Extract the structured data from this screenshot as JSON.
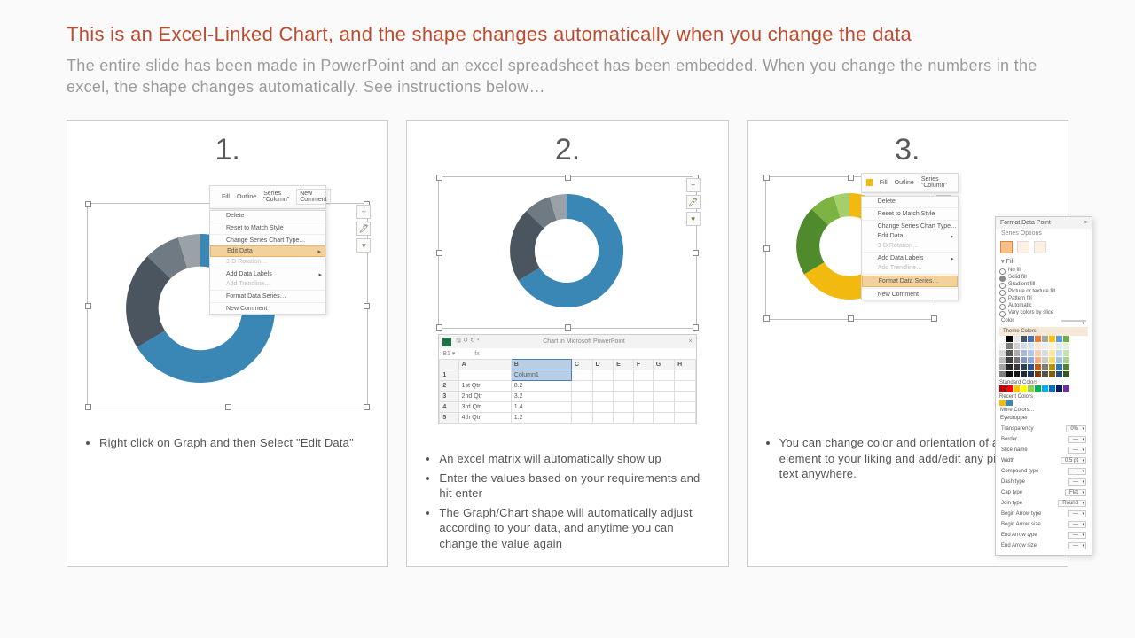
{
  "title": "This is an Excel-Linked Chart, and the shape changes automatically when you change the data",
  "subtitle": "The entire slide has been made in PowerPoint and an excel spreadsheet has been embedded. When you change the numbers in the excel, the shape changes automatically. See instructions below…",
  "cards": [
    {
      "num": "1.",
      "instructions": [
        "Right click on Graph and then Select \"Edit Data\""
      ],
      "menu_top": [
        "Fill",
        "Outline",
        "Series \"Column\"",
        "New Comment"
      ],
      "menu": [
        "Delete",
        "Reset to Match Style",
        "Change Series Chart Type…",
        "Edit Data",
        "3-D Rotation…",
        "Add Data Labels",
        "Add Trendline…",
        "Format Data Series…",
        "New Comment"
      ],
      "menu_highlight": 3
    },
    {
      "num": "2.",
      "instructions": [
        "An excel matrix will automatically show up",
        "Enter the values based on your requirements and hit enter",
        "The Graph/Chart shape will automatically adjust according to your data, and anytime you can change the value again"
      ],
      "sheet_title": "Chart in Microsoft PowerPoint",
      "sheet": {
        "cols": [
          "",
          "A",
          "B",
          "C",
          "D",
          "E",
          "F",
          "G",
          "H"
        ],
        "selcol": "Column1",
        "rows": [
          [
            "1",
            "",
            "Column1",
            "",
            "",
            "",
            "",
            "",
            ""
          ],
          [
            "2",
            "1st Qtr",
            "8.2",
            "",
            "",
            "",
            "",
            "",
            ""
          ],
          [
            "3",
            "2nd Qtr",
            "3.2",
            "",
            "",
            "",
            "",
            "",
            ""
          ],
          [
            "4",
            "3rd Qtr",
            "1.4",
            "",
            "",
            "",
            "",
            "",
            ""
          ],
          [
            "5",
            "4th Qtr",
            "1.2",
            "",
            "",
            "",
            "",
            "",
            ""
          ]
        ]
      }
    },
    {
      "num": "3.",
      "instructions": [
        "You can change color and orientation of any element to your liking and add/edit any piece of text anywhere."
      ],
      "menu_top": [
        "Fill",
        "Outline",
        "Series \"Column\"",
        "New Comment"
      ],
      "menu": [
        "Delete",
        "Reset to Match Style",
        "Change Series Chart Type…",
        "Edit Data",
        "3-D Rotation…",
        "Add Data Labels",
        "Add Trendline…",
        "Format Data Series…",
        "New Comment"
      ],
      "menu_highlight": 7,
      "panel": {
        "title": "Format Data Point",
        "subtitle": "Series Options",
        "fill_label": "Fill",
        "fill_opts": [
          "No fill",
          "Solid fill",
          "Gradient fill",
          "Picture or texture fill",
          "Pattern fill",
          "Automatic",
          "Vary colors by slice"
        ],
        "color_label": "Color",
        "theme_hdr": "Theme Colors",
        "std_hdr": "Standard Colors",
        "recent_hdr": "Recent Colors",
        "more": "More Colors…",
        "eyedrop": "Eyedropper",
        "extra": [
          [
            "Transparency",
            "0%"
          ],
          [
            "Border",
            ""
          ],
          [
            "Slice name",
            ""
          ],
          [
            "Width",
            "0.5 pt"
          ],
          [
            "Compound type",
            ""
          ],
          [
            "Dash type",
            ""
          ],
          [
            "Cap type",
            "Flat"
          ],
          [
            "Join type",
            "Round"
          ],
          [
            "Begin Arrow type",
            ""
          ],
          [
            "Begin Arrow size",
            ""
          ],
          [
            "End Arrow type",
            ""
          ],
          [
            "End Arrow size",
            ""
          ]
        ]
      }
    }
  ],
  "chart_data": [
    {
      "type": "pie",
      "title": "",
      "series": [
        {
          "name": "Column1",
          "values": [
            8.2,
            3.2,
            1.4,
            1.2
          ]
        }
      ],
      "categories": [
        "1st Qtr",
        "2nd Qtr",
        "3rd Qtr",
        "4th Qtr"
      ],
      "colors": [
        "#3a87b5",
        "#9aa2a8",
        "#6f7a82",
        "#4a5560"
      ],
      "note": "donut in card 1"
    },
    {
      "type": "pie",
      "title": "",
      "series": [
        {
          "name": "Column1",
          "values": [
            8.2,
            3.2,
            1.4,
            1.2
          ]
        }
      ],
      "categories": [
        "1st Qtr",
        "2nd Qtr",
        "3rd Qtr",
        "4th Qtr"
      ],
      "colors": [
        "#3a87b5",
        "#9aa2a8",
        "#6f7a82",
        "#4a5560"
      ],
      "note": "donut in card 2"
    },
    {
      "type": "pie",
      "title": "",
      "series": [
        {
          "name": "Column1",
          "values": [
            8.2,
            3.2,
            1.4,
            1.2
          ]
        }
      ],
      "categories": [
        "1st Qtr",
        "2nd Qtr",
        "3rd Qtr",
        "4th Qtr"
      ],
      "colors": [
        "#f2b90f",
        "#a4cf6b",
        "#7db342",
        "#4f8a2c"
      ],
      "note": "donut in card 3"
    }
  ]
}
